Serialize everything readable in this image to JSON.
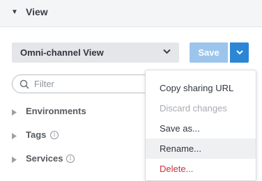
{
  "section": {
    "title": "View"
  },
  "view_select": {
    "value": "Omni-channel View"
  },
  "toolbar": {
    "save_label": "Save"
  },
  "filter": {
    "placeholder": "Filter"
  },
  "tree": {
    "items": [
      {
        "label": "Environments",
        "has_info": false
      },
      {
        "label": "Tags",
        "has_info": true
      },
      {
        "label": "Services",
        "has_info": true
      }
    ]
  },
  "menu": {
    "items": [
      {
        "label": "Copy sharing URL",
        "state": "normal"
      },
      {
        "label": "Discard changes",
        "state": "disabled"
      },
      {
        "label": "Save as...",
        "state": "normal"
      },
      {
        "label": "Rename...",
        "state": "hovered"
      },
      {
        "label": "Delete...",
        "state": "danger"
      }
    ]
  },
  "colors": {
    "primary": "#2b86d6",
    "save_disabled": "#9cc5ec",
    "danger": "#c8323c"
  }
}
